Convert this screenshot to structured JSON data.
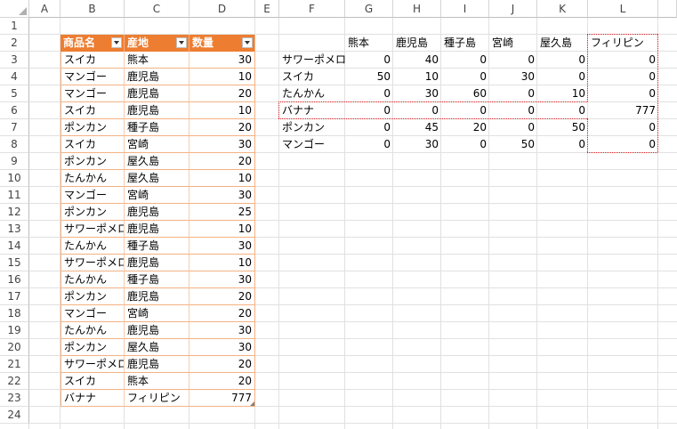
{
  "columns": [
    "A",
    "B",
    "C",
    "D",
    "E",
    "F",
    "G",
    "H",
    "I",
    "J",
    "K",
    "L"
  ],
  "rows": [
    "1",
    "2",
    "3",
    "4",
    "5",
    "6",
    "7",
    "8",
    "9",
    "10",
    "11",
    "12",
    "13",
    "14",
    "15",
    "16",
    "17",
    "18",
    "19",
    "20",
    "21",
    "22",
    "23",
    "24"
  ],
  "table": {
    "headers": [
      "商品名",
      "産地",
      "数量"
    ],
    "rows": [
      [
        "スイカ",
        "熊本",
        "30"
      ],
      [
        "マンゴー",
        "鹿児島",
        "10"
      ],
      [
        "マンゴー",
        "鹿児島",
        "20"
      ],
      [
        "スイカ",
        "鹿児島",
        "10"
      ],
      [
        "ポンカン",
        "種子島",
        "20"
      ],
      [
        "スイカ",
        "宮崎",
        "30"
      ],
      [
        "ポンカン",
        "屋久島",
        "20"
      ],
      [
        "たんかん",
        "屋久島",
        "10"
      ],
      [
        "マンゴー",
        "宮崎",
        "30"
      ],
      [
        "ポンカン",
        "鹿児島",
        "25"
      ],
      [
        "サワーポメロ",
        "鹿児島",
        "10"
      ],
      [
        "たんかん",
        "種子島",
        "30"
      ],
      [
        "サワーポメロ",
        "鹿児島",
        "10"
      ],
      [
        "たんかん",
        "種子島",
        "30"
      ],
      [
        "ポンカン",
        "鹿児島",
        "20"
      ],
      [
        "マンゴー",
        "宮崎",
        "20"
      ],
      [
        "たんかん",
        "鹿児島",
        "30"
      ],
      [
        "ポンカン",
        "屋久島",
        "30"
      ],
      [
        "サワーポメロ",
        "鹿児島",
        "20"
      ],
      [
        "スイカ",
        "熊本",
        "20"
      ],
      [
        "バナナ",
        "フィリピン",
        "777"
      ]
    ]
  },
  "crosstab": {
    "headers": [
      "熊本",
      "鹿児島",
      "種子島",
      "宮崎",
      "屋久島",
      "フィリピン"
    ],
    "rows": [
      {
        "label": "サワーポメロ",
        "values": [
          "0",
          "40",
          "0",
          "0",
          "0",
          "0"
        ]
      },
      {
        "label": "スイカ",
        "values": [
          "50",
          "10",
          "0",
          "30",
          "0",
          "0"
        ]
      },
      {
        "label": "たんかん",
        "values": [
          "0",
          "30",
          "60",
          "0",
          "10",
          "0"
        ]
      },
      {
        "label": "バナナ",
        "values": [
          "0",
          "0",
          "0",
          "0",
          "0",
          "777"
        ]
      },
      {
        "label": "ポンカン",
        "values": [
          "0",
          "45",
          "20",
          "0",
          "50",
          "0"
        ]
      },
      {
        "label": "マンゴー",
        "values": [
          "0",
          "30",
          "0",
          "50",
          "0",
          "0"
        ]
      }
    ]
  },
  "colors": {
    "table_header": "#ed7d31",
    "table_border": "#f4b183",
    "highlight_dash": "#e02020"
  }
}
